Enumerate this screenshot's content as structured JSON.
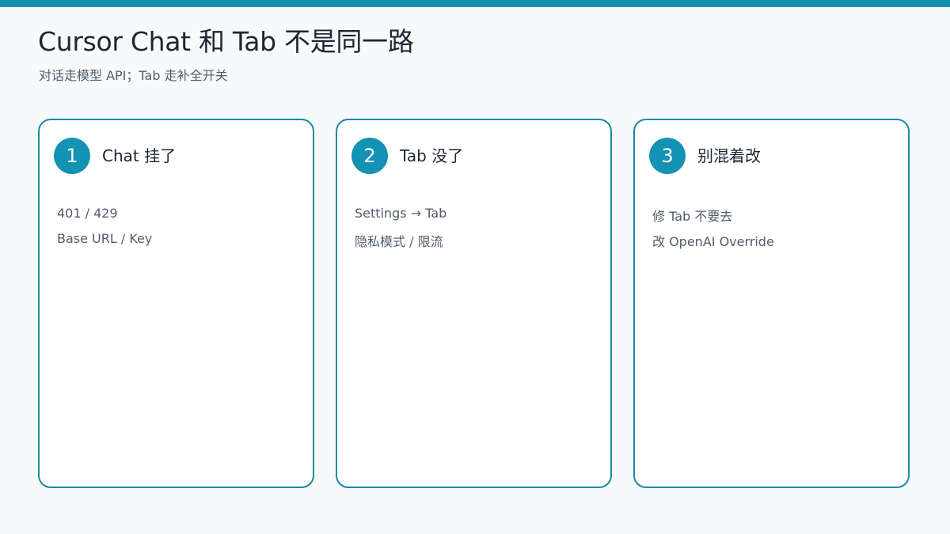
{
  "header": {
    "title": "Cursor Chat 和 Tab 不是同一路",
    "subtitle": "对话走模型 API；Tab 走补全开关"
  },
  "cards": [
    {
      "number": "1",
      "title": "Chat 挂了",
      "lines": [
        "401 / 429",
        "Base URL / Key"
      ]
    },
    {
      "number": "2",
      "title": "Tab 没了",
      "lines": [
        "Settings → Tab",
        "隐私模式 / 限流"
      ]
    },
    {
      "number": "3",
      "title": "别混着改",
      "lines": [
        "修 Tab 不要去",
        "改 OpenAI Override"
      ]
    }
  ],
  "colors": {
    "accent": "#0f8fad",
    "card_border": "#1a8aa8",
    "background": "#f7f9fb"
  }
}
